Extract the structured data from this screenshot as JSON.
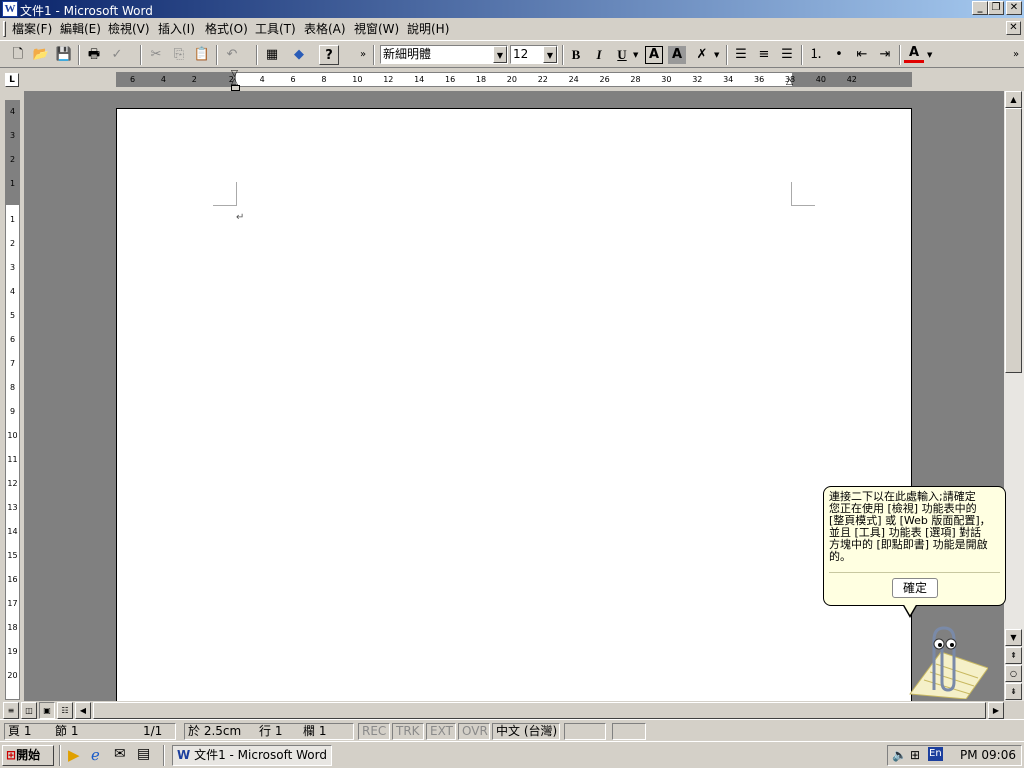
{
  "window": {
    "title": "文件1 - Microsoft Word",
    "app_icon": "W"
  },
  "menu": [
    "檔案(F)",
    "編輯(E)",
    "檢視(V)",
    "插入(I)",
    "格式(O)",
    "工具(T)",
    "表格(A)",
    "視窗(W)",
    "說明(H)"
  ],
  "toolbar": {
    "font_name": "新細明體",
    "font_size": "12",
    "bold": "B",
    "italic": "I",
    "underline": "U",
    "char_border": "A",
    "char_shade": "A",
    "font_color": "A",
    "help": "?"
  },
  "ruler": {
    "box": "L",
    "h_numbers": [
      "6",
      "4",
      "2",
      "2",
      "4",
      "6",
      "8",
      "10",
      "12",
      "14",
      "16",
      "18",
      "20",
      "22",
      "24",
      "26",
      "28",
      "30",
      "32",
      "34",
      "36",
      "38",
      "40",
      "42"
    ],
    "v_numbers": [
      "4",
      "3",
      "2",
      "1",
      "1",
      "2",
      "3",
      "4",
      "5",
      "6",
      "7",
      "8",
      "9",
      "10",
      "11",
      "12",
      "13",
      "14",
      "15",
      "16",
      "17",
      "18",
      "19",
      "20"
    ]
  },
  "document": {
    "paragraph_mark": "↵"
  },
  "balloon": {
    "message": "連接二下以在此處輸入;請確定\n您正在使用 [檢視] 功能表中的\n[整頁模式] 或 [Web 版面配置]，\n並且 [工具] 功能表 [選項] 對話\n方塊中的 [即點即書] 功能是開啟\n的。",
    "ok": "確定"
  },
  "status": {
    "page": "頁 1",
    "section": "節 1",
    "pages": "1/1",
    "at": "於 2.5cm",
    "line": "行 1",
    "col": "欄 1",
    "rec": "REC",
    "trk": "TRK",
    "ext": "EXT",
    "ovr": "OVR",
    "lang": "中文 (台灣)"
  },
  "taskbar": {
    "start": "開始",
    "task": "文件1 - Microsoft Word",
    "clock": "PM 09:06",
    "ime": "En"
  }
}
